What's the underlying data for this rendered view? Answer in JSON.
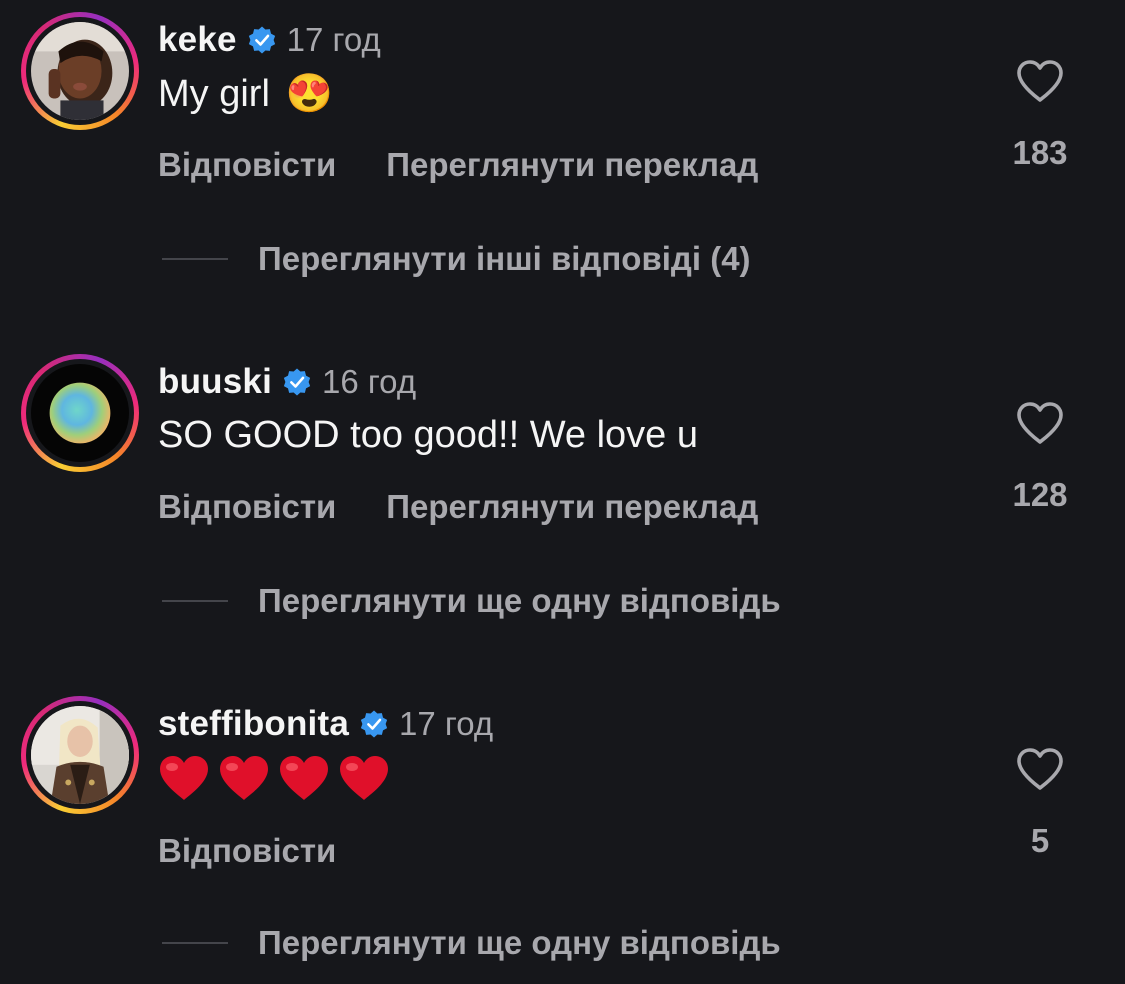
{
  "comments": [
    {
      "username": "keke",
      "time": "17 год",
      "text": "My girl",
      "emoji": "😍",
      "reply_label": "Відповісти",
      "translate_label": "Переглянути переклад",
      "likes": "183",
      "more_replies": "Переглянути інші відповіді (4)"
    },
    {
      "username": "buuski",
      "time": "16 год",
      "text": "SO GOOD too good!! We love u",
      "reply_label": "Відповісти",
      "translate_label": "Переглянути переклад",
      "likes": "128",
      "more_replies": "Переглянути ще одну відповідь"
    },
    {
      "username": "steffibonita",
      "time": "17 год",
      "text": "❤️❤️❤️❤️",
      "reply_label": "Відповісти",
      "likes": "5",
      "more_replies": "Переглянути ще одну відповідь"
    }
  ],
  "icons": {
    "verified": "verified-badge-icon",
    "like": "heart-outline-icon"
  },
  "colors": {
    "background": "#16171b",
    "verified": "#3897f0",
    "muted_text": "#a8a8ad"
  }
}
